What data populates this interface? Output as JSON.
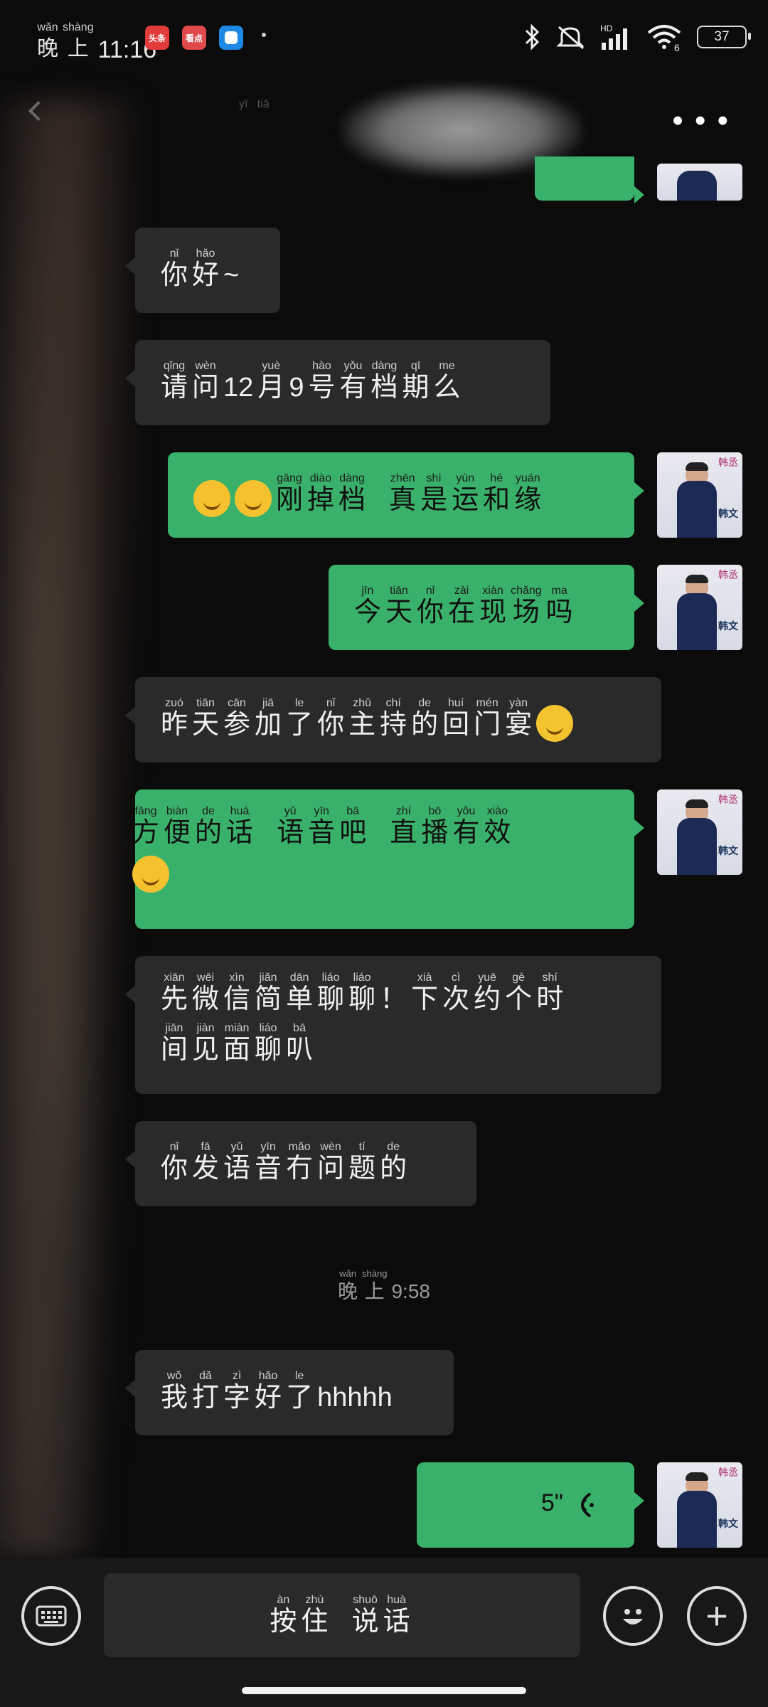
{
  "status_bar": {
    "time_pinyin": [
      "wǎn",
      "shàng"
    ],
    "time_chars": [
      "晚",
      "上"
    ],
    "time": "11:16",
    "battery": "37",
    "sim_label": "6",
    "apps": [
      {
        "label": "头条",
        "color": "#e23b3b"
      },
      {
        "label": "看点",
        "color": "#e04a4a"
      },
      {
        "label": "",
        "color": "#1e88e5"
      }
    ],
    "icons": [
      "bluetooth-icon",
      "mute-icon",
      "signal-icon",
      "wifi-icon",
      "battery-icon"
    ]
  },
  "header": {
    "partial_title_pinyin": "yī   tiā",
    "menu_icon": "more-icon"
  },
  "messages": [
    {
      "dir": "in",
      "lines": [
        [
          [
            "nǐ",
            "你"
          ],
          [
            "hǎo",
            "好"
          ],
          [
            "",
            "~"
          ]
        ]
      ]
    },
    {
      "dir": "in",
      "lines": [
        [
          [
            "qǐng",
            "请"
          ],
          [
            "wèn",
            "问"
          ],
          [
            "",
            "12"
          ],
          [
            "yuè",
            "月"
          ],
          [
            "",
            "9"
          ],
          [
            "hào",
            "号"
          ],
          [
            "yǒu",
            "有"
          ],
          [
            "dàng",
            "档"
          ],
          [
            "qī",
            "期"
          ],
          [
            "me",
            "么"
          ]
        ]
      ]
    },
    {
      "dir": "out",
      "lines": [
        [
          [
            "",
            "emoji-tears"
          ],
          [
            "",
            "emoji-tears"
          ],
          [
            "gāng",
            "刚"
          ],
          [
            "diào",
            "掉"
          ],
          [
            "dàng",
            "档"
          ],
          [
            "",
            "  "
          ],
          [
            "zhēn",
            "真"
          ],
          [
            "shì",
            "是"
          ],
          [
            "yùn",
            "运"
          ],
          [
            "hé",
            "和"
          ],
          [
            "yuán",
            "缘"
          ]
        ]
      ]
    },
    {
      "dir": "out",
      "lines": [
        [
          [
            "jīn",
            "今"
          ],
          [
            "tiān",
            "天"
          ],
          [
            "nǐ",
            "你"
          ],
          [
            "zài",
            "在"
          ],
          [
            "xiàn",
            "现"
          ],
          [
            "chǎng",
            "场"
          ],
          [
            "ma",
            "吗"
          ]
        ]
      ]
    },
    {
      "dir": "in",
      "lines": [
        [
          [
            "zuó",
            "昨"
          ],
          [
            "tiān",
            "天"
          ],
          [
            "cān",
            "参"
          ],
          [
            "jiā",
            "加"
          ],
          [
            "le",
            "了"
          ],
          [
            "nǐ",
            "你"
          ],
          [
            "zhǔ",
            "主"
          ],
          [
            "chí",
            "持"
          ],
          [
            "de",
            "的"
          ],
          [
            "huí",
            "回"
          ],
          [
            "mén",
            "门"
          ],
          [
            "yàn",
            "宴"
          ],
          [
            "",
            "emoji-grin"
          ]
        ]
      ]
    },
    {
      "dir": "out",
      "lines": [
        [
          [
            "fāng",
            "方"
          ],
          [
            "biàn",
            "便"
          ],
          [
            "de",
            "的"
          ],
          [
            "huà",
            "话"
          ],
          [
            "",
            "  "
          ],
          [
            "yǔ",
            "语"
          ],
          [
            "yīn",
            "音"
          ],
          [
            "bā",
            "吧"
          ],
          [
            "",
            "  "
          ],
          [
            "zhí",
            "直"
          ],
          [
            "bō",
            "播"
          ],
          [
            "yǒu",
            "有"
          ],
          [
            "xiào",
            "效"
          ]
        ],
        [
          [
            "",
            "emoji-wink"
          ]
        ]
      ]
    },
    {
      "dir": "in",
      "lines": [
        [
          [
            "xiān",
            "先"
          ],
          [
            "wēi",
            "微"
          ],
          [
            "xìn",
            "信"
          ],
          [
            "jiǎn",
            "简"
          ],
          [
            "dān",
            "单"
          ],
          [
            "liáo",
            "聊"
          ],
          [
            "liáo",
            "聊"
          ],
          [
            "",
            "！"
          ],
          [
            "xià",
            "下"
          ],
          [
            "cì",
            "次"
          ],
          [
            "yuē",
            "约"
          ],
          [
            "gè",
            "个"
          ],
          [
            "shí",
            "时"
          ]
        ],
        [
          [
            "jiān",
            "间"
          ],
          [
            "jiàn",
            "见"
          ],
          [
            "miàn",
            "面"
          ],
          [
            "liáo",
            "聊"
          ],
          [
            "bā",
            "叭"
          ]
        ]
      ]
    },
    {
      "dir": "in",
      "lines": [
        [
          [
            "nǐ",
            "你"
          ],
          [
            "fā",
            "发"
          ],
          [
            "yǔ",
            "语"
          ],
          [
            "yīn",
            "音"
          ],
          [
            "mǎo",
            "冇"
          ],
          [
            "wèn",
            "问"
          ],
          [
            "tí",
            "题"
          ],
          [
            "de",
            "的"
          ]
        ]
      ]
    },
    {
      "dir": "in",
      "lines": [
        [
          [
            "wǒ",
            "我"
          ],
          [
            "dǎ",
            "打"
          ],
          [
            "zì",
            "字"
          ],
          [
            "hǎo",
            "好"
          ],
          [
            "le",
            "了"
          ],
          [
            "",
            "hhhhh"
          ]
        ]
      ]
    }
  ],
  "timestamp": {
    "pinyin": [
      "wǎn",
      "shàng"
    ],
    "chars": [
      "晚",
      "上"
    ],
    "time": "9:58"
  },
  "voice_message": {
    "duration": "5\"",
    "icon": "voice-wave-icon"
  },
  "avatar": {
    "mark": "韩丞",
    "brand": "韩文"
  },
  "input_bar": {
    "hold_label": [
      [
        "àn",
        "按"
      ],
      [
        "zhù",
        "住"
      ],
      [
        "",
        " "
      ],
      [
        "shuō",
        "说"
      ],
      [
        "huà",
        "话"
      ]
    ],
    "keyboard_icon": "keyboard-icon",
    "emoji_icon": "emoji-icon",
    "plus_icon": "plus-icon"
  }
}
